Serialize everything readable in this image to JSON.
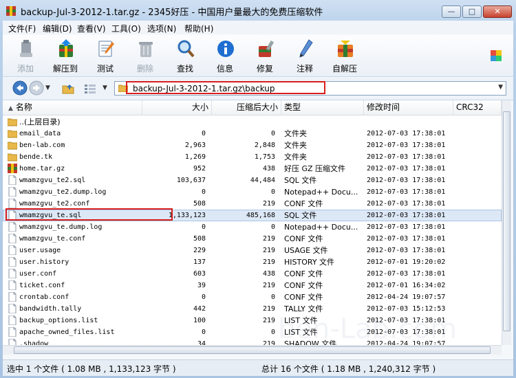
{
  "window": {
    "title": "backup-Jul-3-2012-1.tar.gz - 2345好压 - 中国用户量最大的免费压缩软件",
    "controls": {
      "minimize": "—",
      "maximize": "□",
      "close": "✕"
    }
  },
  "menu": [
    "文件(F)",
    "编辑(D)",
    "查看(V)",
    "工具(O)",
    "选项(N)",
    "帮助(H)"
  ],
  "toolbar": [
    {
      "label": "添加",
      "icon": "add-icon",
      "disabled": true
    },
    {
      "label": "解压到",
      "icon": "extract-icon",
      "disabled": false
    },
    {
      "label": "测试",
      "icon": "test-icon",
      "disabled": false
    },
    {
      "label": "删除",
      "icon": "delete-icon",
      "disabled": true
    },
    {
      "label": "查找",
      "icon": "find-icon",
      "disabled": false
    },
    {
      "label": "信息",
      "icon": "info-icon",
      "disabled": false
    },
    {
      "label": "修复",
      "icon": "repair-icon",
      "disabled": false
    },
    {
      "label": "注释",
      "icon": "comment-icon",
      "disabled": false
    },
    {
      "label": "自解压",
      "icon": "sfx-icon",
      "disabled": false
    }
  ],
  "address": {
    "path": "backup-Jul-3-2012-1.tar.gz\\backup"
  },
  "columns": {
    "name": "名称",
    "size": "大小",
    "compressed": "压缩后大小",
    "type": "类型",
    "modified": "修改时间",
    "crc": "CRC32"
  },
  "files": [
    {
      "name": "..(上层目录)",
      "size": "",
      "compressed": "",
      "type": "",
      "modified": "",
      "icon": "folder-up-icon"
    },
    {
      "name": "email_data",
      "size": "0",
      "compressed": "0",
      "type": "文件夹",
      "modified": "2012-07-03 17:38:01",
      "icon": "folder-icon"
    },
    {
      "name": "ben-lab.com",
      "size": "2,963",
      "compressed": "2,848",
      "type": "文件夹",
      "modified": "2012-07-03 17:38:01",
      "icon": "folder-icon"
    },
    {
      "name": "bende.tk",
      "size": "1,269",
      "compressed": "1,753",
      "type": "文件夹",
      "modified": "2012-07-03 17:38:01",
      "icon": "folder-icon"
    },
    {
      "name": "home.tar.gz",
      "size": "952",
      "compressed": "438",
      "type": "好压 GZ 压缩文件",
      "modified": "2012-07-03 17:38:01",
      "icon": "archive-icon"
    },
    {
      "name": "wmamzgvu_te2.sql",
      "size": "103,637",
      "compressed": "44,484",
      "type": "SQL 文件",
      "modified": "2012-07-03 17:38:01",
      "icon": "file-icon"
    },
    {
      "name": "wmamzgvu_te2.dump.log",
      "size": "0",
      "compressed": "0",
      "type": "Notepad++ Docu...",
      "modified": "2012-07-03 17:38:01",
      "icon": "file-icon"
    },
    {
      "name": "wmamzgvu_te2.conf",
      "size": "508",
      "compressed": "219",
      "type": "CONF 文件",
      "modified": "2012-07-03 17:38:01",
      "icon": "file-icon"
    },
    {
      "name": "wmamzgvu_te.sql",
      "size": "1,133,123",
      "compressed": "485,168",
      "type": "SQL 文件",
      "modified": "2012-07-03 17:38:01",
      "icon": "file-icon",
      "selected": true
    },
    {
      "name": "wmamzgvu_te.dump.log",
      "size": "0",
      "compressed": "0",
      "type": "Notepad++ Docu...",
      "modified": "2012-07-03 17:38:01",
      "icon": "file-icon"
    },
    {
      "name": "wmamzgvu_te.conf",
      "size": "508",
      "compressed": "219",
      "type": "CONF 文件",
      "modified": "2012-07-03 17:38:01",
      "icon": "file-icon"
    },
    {
      "name": "user.usage",
      "size": "229",
      "compressed": "219",
      "type": "USAGE 文件",
      "modified": "2012-07-03 17:38:01",
      "icon": "file-icon"
    },
    {
      "name": "user.history",
      "size": "137",
      "compressed": "219",
      "type": "HISTORY 文件",
      "modified": "2012-07-01 19:20:02",
      "icon": "file-icon"
    },
    {
      "name": "user.conf",
      "size": "603",
      "compressed": "438",
      "type": "CONF 文件",
      "modified": "2012-07-03 17:38:01",
      "icon": "file-icon"
    },
    {
      "name": "ticket.conf",
      "size": "39",
      "compressed": "219",
      "type": "CONF 文件",
      "modified": "2012-07-01 16:34:02",
      "icon": "file-icon"
    },
    {
      "name": "crontab.conf",
      "size": "0",
      "compressed": "0",
      "type": "CONF 文件",
      "modified": "2012-04-24 19:07:57",
      "icon": "file-icon"
    },
    {
      "name": "bandwidth.tally",
      "size": "442",
      "compressed": "219",
      "type": "TALLY 文件",
      "modified": "2012-07-03 15:12:53",
      "icon": "file-icon"
    },
    {
      "name": "backup_options.list",
      "size": "100",
      "compressed": "219",
      "type": "LIST 文件",
      "modified": "2012-07-03 17:38:01",
      "icon": "file-icon"
    },
    {
      "name": "apache_owned_files.list",
      "size": "0",
      "compressed": "0",
      "type": "LIST 文件",
      "modified": "2012-07-03 17:38:01",
      "icon": "file-icon"
    },
    {
      "name": ".shadow",
      "size": "34",
      "compressed": "219",
      "type": "SHADOW 文件",
      "modified": "2012-04-24 19:07:57",
      "icon": "file-icon"
    }
  ],
  "status": {
    "left": "选中 1 个文件 ( 1.08 MB , 1,133,123 字节 )",
    "right": "总计 16 个文件 ( 1.18 MB , 1,240,312 字节 )"
  },
  "watermark": "ben-Lab.com",
  "colors": {
    "highlight_box": "#d81e1e",
    "selection": "#dde8f6",
    "folder": "#e8b94a"
  }
}
